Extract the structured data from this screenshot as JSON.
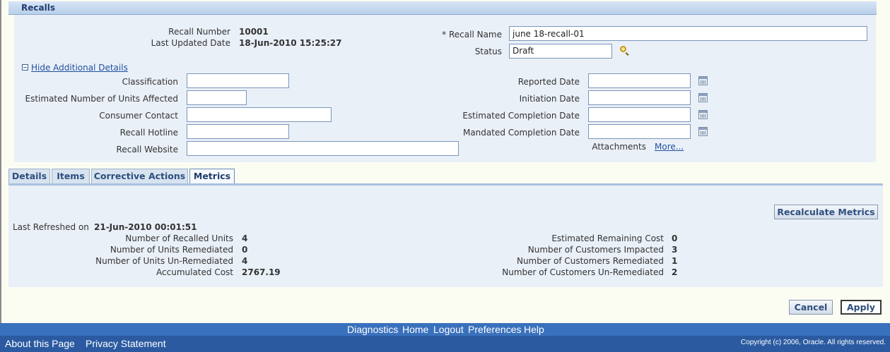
{
  "section": {
    "title": "Recalls"
  },
  "header_fields": {
    "recall_number_label": "Recall Number",
    "recall_number": "10001",
    "last_updated_label": "Last Updated Date",
    "last_updated": "18-Jun-2010 15:25:27",
    "recall_name_label": "* Recall Name",
    "recall_name": "june 18-recall-01",
    "status_label": "Status",
    "status": "Draft"
  },
  "details": {
    "hide_link": "Hide Additional Details",
    "classification_label": "Classification",
    "units_affected_label": "Estimated Number of Units Affected",
    "consumer_contact_label": "Consumer Contact",
    "hotline_label": "Recall Hotline",
    "website_label": "Recall Website",
    "reported_label": "Reported Date",
    "initiation_label": "Initiation Date",
    "est_completion_label": "Estimated Completion Date",
    "mandated_label": "Mandated Completion Date",
    "attachments_label": "Attachments",
    "attachments_more": "More..."
  },
  "tabs": [
    "Details",
    "Items",
    "Corrective Actions",
    "Metrics"
  ],
  "active_tab": "Metrics",
  "metrics": {
    "recalculate_button": "Recalculate Metrics",
    "last_refreshed_label": "Last Refreshed on",
    "last_refreshed": "21-Jun-2010 00:01:51",
    "left": [
      {
        "label": "Number of Recalled Units",
        "value": "4"
      },
      {
        "label": "Number of Units Remediated",
        "value": "0"
      },
      {
        "label": "Number of Units Un-Remediated",
        "value": "4"
      },
      {
        "label": "Accumulated Cost",
        "value": "2767.19"
      }
    ],
    "right": [
      {
        "label": "Estimated Remaining Cost",
        "value": "0"
      },
      {
        "label": "Number of Customers Impacted",
        "value": "3"
      },
      {
        "label": "Number of Customers Remediated",
        "value": "1"
      },
      {
        "label": "Number of Customers Un-Remediated",
        "value": "2"
      }
    ]
  },
  "buttons": {
    "cancel": "Cancel",
    "apply": "Apply"
  },
  "footer": {
    "links": [
      "Diagnostics",
      "Home",
      "Logout",
      "Preferences",
      "Help"
    ],
    "about": "About this Page",
    "privacy": "Privacy Statement",
    "copyright": "Copyright (c) 2006, Oracle. All rights reserved."
  }
}
